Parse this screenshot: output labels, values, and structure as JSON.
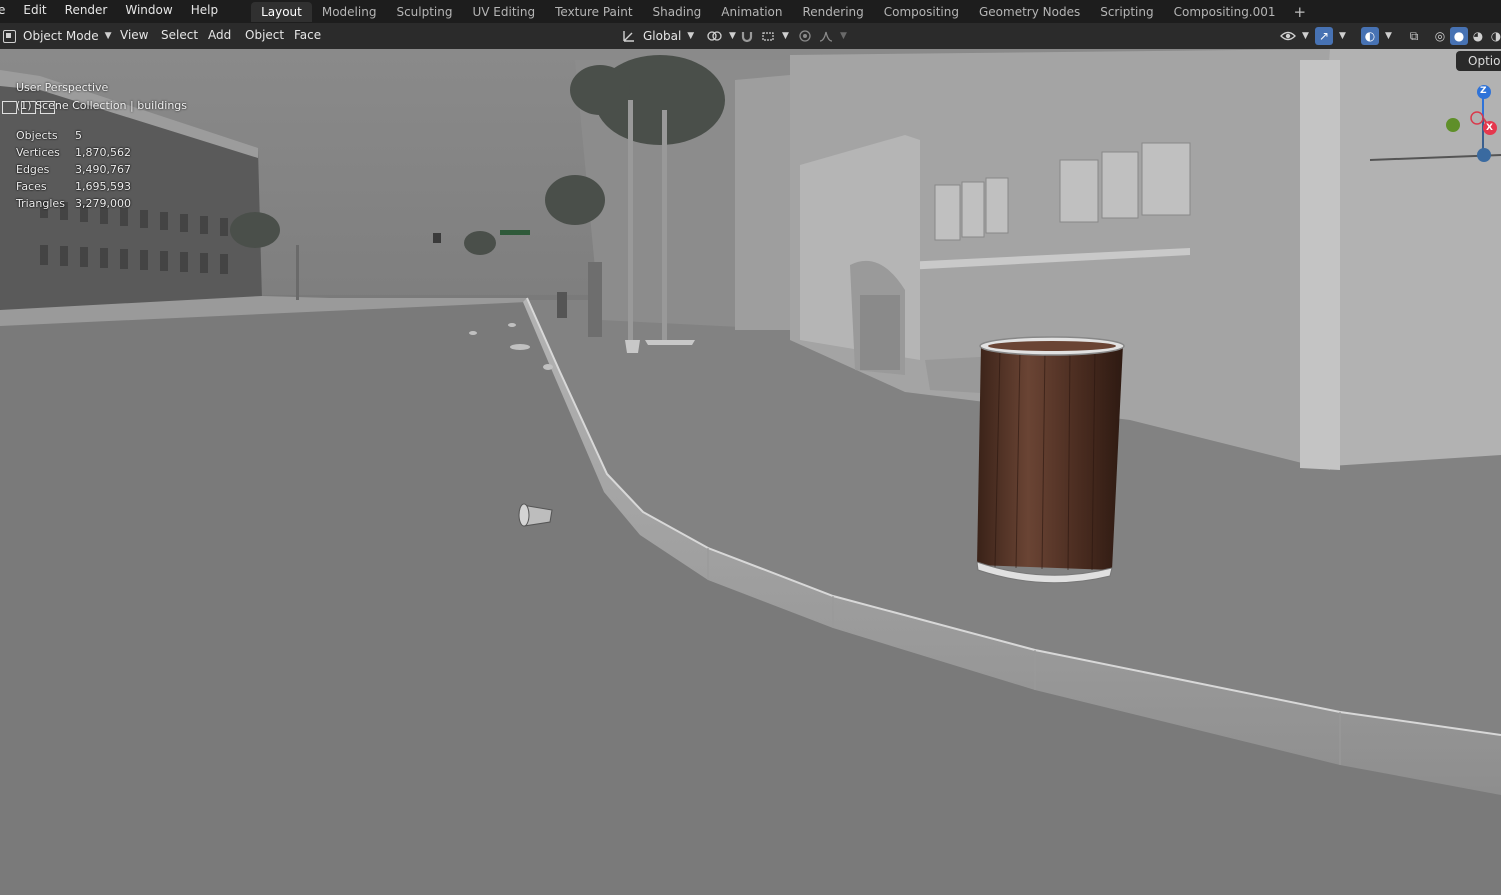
{
  "top_menu": [
    "e",
    "Edit",
    "Render",
    "Window",
    "Help"
  ],
  "workspace_tabs": [
    {
      "label": "Layout",
      "active": true
    },
    {
      "label": "Modeling"
    },
    {
      "label": "Sculpting"
    },
    {
      "label": "UV Editing"
    },
    {
      "label": "Texture Paint"
    },
    {
      "label": "Shading"
    },
    {
      "label": "Animation"
    },
    {
      "label": "Rendering"
    },
    {
      "label": "Compositing"
    },
    {
      "label": "Geometry Nodes"
    },
    {
      "label": "Scripting"
    },
    {
      "label": "Compositing.001"
    }
  ],
  "add_tab": "+",
  "header": {
    "mode": "Object Mode",
    "menus": [
      "View",
      "Select",
      "Add",
      "Object",
      "Face"
    ],
    "transform_orientation": "Global",
    "options": "Options"
  },
  "overlay": {
    "perspective": "User Perspective",
    "collection": "(1) Scene Collection | buildings",
    "stats": [
      {
        "label": "Objects",
        "value": "5"
      },
      {
        "label": "Vertices",
        "value": "1,870,562"
      },
      {
        "label": "Edges",
        "value": "3,490,767"
      },
      {
        "label": "Faces",
        "value": "1,695,593"
      },
      {
        "label": "Triangles",
        "value": "3,279,000"
      }
    ]
  },
  "gizmo": {
    "z": "Z",
    "x": "X"
  },
  "colors": {
    "topbar": "#1d1d1d",
    "header": "#2b2b2b",
    "active_tab": "#303030",
    "accent_blue": "#4772b3",
    "viewport": "#777777"
  }
}
